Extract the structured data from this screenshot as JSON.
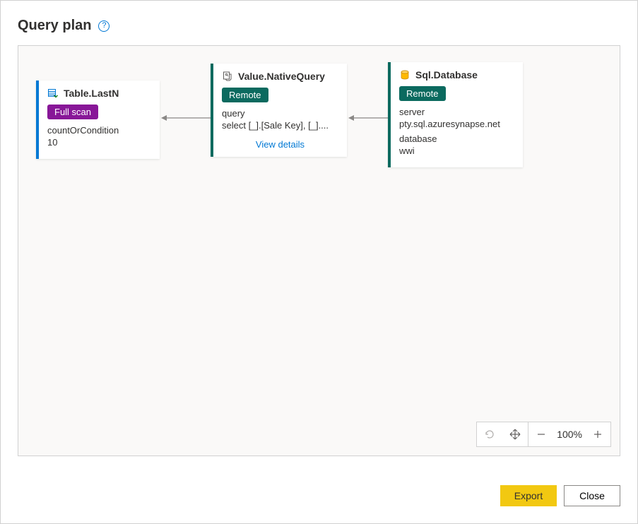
{
  "title": "Query plan",
  "nodes": {
    "tableLastN": {
      "title": "Table.LastN",
      "badge": "Full scan",
      "field_label": "countOrCondition",
      "field_value": "10"
    },
    "valueNativeQuery": {
      "title": "Value.NativeQuery",
      "badge": "Remote",
      "field_label": "query",
      "field_value": "select [_].[Sale Key], [_]....",
      "view_details": "View details"
    },
    "sqlDatabase": {
      "title": "Sql.Database",
      "badge": "Remote",
      "server_label": "server",
      "server_value": "pty.sql.azuresynapse.net",
      "database_label": "database",
      "database_value": "wwi"
    }
  },
  "toolbar": {
    "zoom_level": "100%"
  },
  "footer": {
    "export_label": "Export",
    "close_label": "Close"
  }
}
